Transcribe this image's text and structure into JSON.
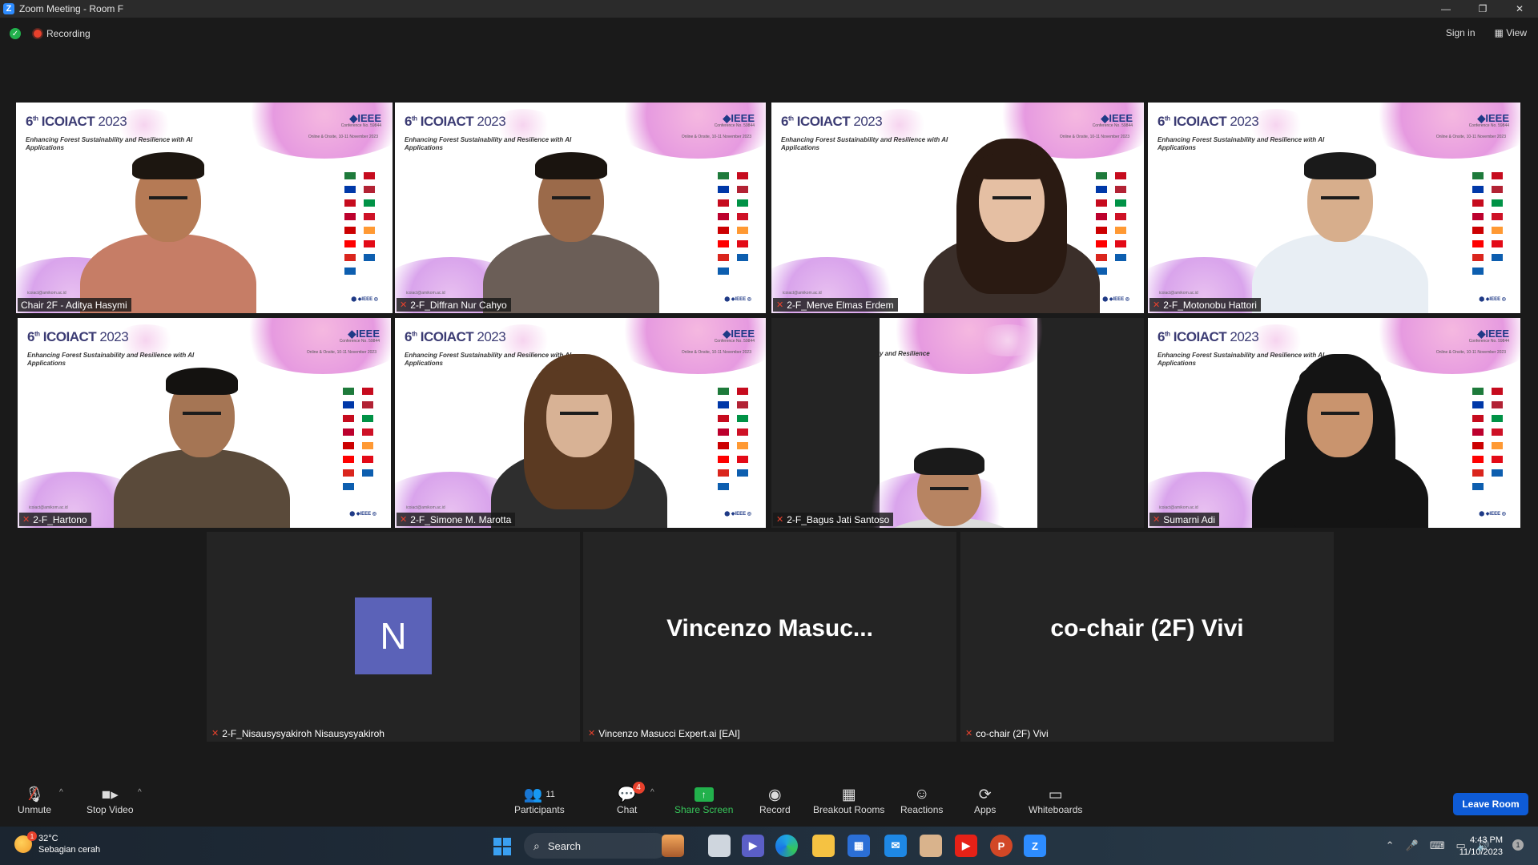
{
  "window": {
    "title": "Zoom Meeting - Room F",
    "minimize": "—",
    "restore": "❐",
    "close": "✕"
  },
  "status": {
    "recording": "Recording",
    "sign_in": "Sign in",
    "view": "View"
  },
  "slide": {
    "ordinal": "6",
    "ordinal_suffix": "th",
    "name": "ICOIACT",
    "year": "2023",
    "theme": "Enhancing Forest Sustainability and Resilience with AI Applications",
    "theme_partial": "y and Resilience",
    "ieee": "IEEE",
    "conf_no": "Conference No. 59844",
    "date": "Online & Onsite, 10-11 November 2023",
    "footer": "IEEE",
    "url": "icoiact@amikom.ac.id"
  },
  "participants": [
    {
      "name": "Chair 2F - Aditya Hasymi",
      "muted": false,
      "active": true
    },
    {
      "name": "2-F_Diffran Nur Cahyo",
      "muted": true
    },
    {
      "name": "2-F_Merve Elmas Erdem",
      "muted": true
    },
    {
      "name": "2-F_Motonobu Hattori",
      "muted": true
    },
    {
      "name": "2-F_Hartono",
      "muted": true
    },
    {
      "name": "2-F_Simone M. Marotta",
      "muted": true
    },
    {
      "name": "2-F_Bagus Jati Santoso",
      "muted": true
    },
    {
      "name": "Sumarni Adi",
      "muted": true
    },
    {
      "name": "2-F_Nisausysyakiroh Nisausysyakiroh",
      "muted": true,
      "avatar": "N"
    },
    {
      "name": "Vincenzo Masucci Expert.ai [EAI]",
      "muted": true,
      "display": "Vincenzo  Masuc..."
    },
    {
      "name": "co-chair (2F) Vivi",
      "muted": true,
      "display": "co-chair (2F) Vivi"
    }
  ],
  "toolbar": {
    "unmute": "Unmute",
    "stop_video": "Stop Video",
    "participants": "Participants",
    "participants_count": "11",
    "chat": "Chat",
    "chat_badge": "4",
    "share": "Share Screen",
    "record": "Record",
    "breakout": "Breakout Rooms",
    "reactions": "Reactions",
    "apps": "Apps",
    "whiteboards": "Whiteboards",
    "leave": "Leave Room"
  },
  "taskbar": {
    "temp": "32°C",
    "weather": "Sebagian cerah",
    "weather_badge": "1",
    "search": "Search",
    "time": "4:43 PM",
    "date": "11/10/2023",
    "notif": "1"
  },
  "colors": {
    "accent": "#0e5bd6",
    "active_border": "#d8e84f",
    "share_green": "#22b14c",
    "muted_red": "#e8412c",
    "avatar": "#5b62b8"
  }
}
